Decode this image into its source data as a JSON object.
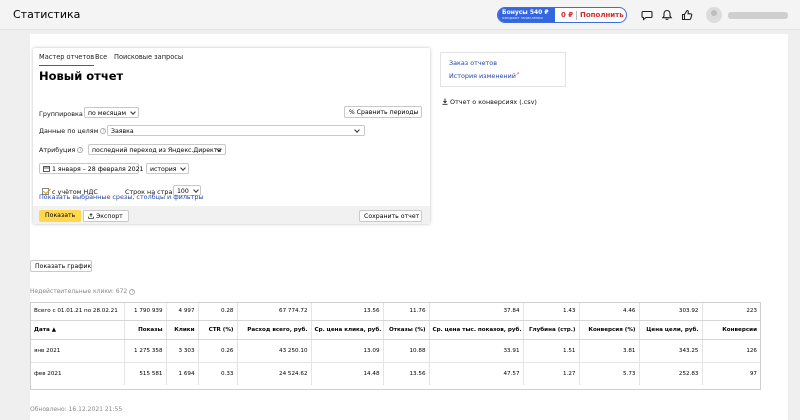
{
  "header": {
    "title": "Статистика",
    "bonus_title": "Бонусы 540 ₽",
    "bonus_subtitle": "ожидают зачисления",
    "balance": "0 ₽",
    "topup_label": "Пополнить",
    "icons": [
      "chat-icon",
      "bell-icon",
      "thumbs-up-icon",
      "avatar-icon"
    ]
  },
  "tabs": [
    {
      "label": "Мастер отчетов",
      "active": true
    },
    {
      "label": "Все",
      "active": false
    },
    {
      "label": "Поисковые запросы",
      "active": false
    }
  ],
  "report": {
    "title": "Новый отчет",
    "grouping_label": "Группировка",
    "grouping_value": "по месяцам",
    "compare_label": "Сравнить периоды",
    "goals_label": "Данные по целям",
    "goals_value": "Заявка",
    "attribution_label": "Атрибуция",
    "attribution_value": "последний переход из Яндекс.Директа",
    "date_range": "1 января – 28 февраля 2021",
    "history_label": "история",
    "vat_label": "с учётом НДС",
    "vat_checked": true,
    "rows_label": "Строк на странице",
    "rows_value": "100",
    "slices_link": "Показать выбранные срезы, столбцы и фильтры",
    "show_button": "Показать",
    "export_button": "Экспорт",
    "save_button": "Сохранить отчет"
  },
  "side": {
    "order_reports": "Заказ отчетов",
    "change_history": "История изменений",
    "conversions_report": "Отчет о конверсиях (.csv)"
  },
  "show_chart_button": "Показать график",
  "invalid_clicks": "Недействительные клики: 672",
  "table": {
    "total": [
      "Всего с 01.01.21 по 28.02.21",
      "1 790 939",
      "4 997",
      "0.28",
      "67 774.72",
      "13.56",
      "11.76",
      "37.84",
      "1.43",
      "4.46",
      "303.92",
      "223"
    ],
    "headers": [
      "Дата ▲",
      "Показы",
      "Клики",
      "CTR (%)",
      "Расход всего, руб.",
      "Ср. цена клика, руб.",
      "Отказы (%)",
      "Ср. цена тыс. показов, руб.",
      "Глубина (стр.)",
      "Конверсия (%)",
      "Цена цели, руб.",
      "Конверсии"
    ],
    "rows": [
      [
        "янв 2021",
        "1 275 358",
        "3 303",
        "0.26",
        "43 250.10",
        "13.09",
        "10.88",
        "33.91",
        "1.51",
        "3.81",
        "343.25",
        "126"
      ],
      [
        "фев 2021",
        "515 581",
        "1 694",
        "0.33",
        "24 524.62",
        "14.48",
        "13.56",
        "47.57",
        "1.27",
        "5.73",
        "252.83",
        "97"
      ]
    ]
  },
  "updated": "Обновлено: 16.12.2021 21:55",
  "colors": {
    "accent": "#ffd84c",
    "link": "#2345a8",
    "brand_blue": "#3466dd",
    "alert_red": "#d42c2c"
  }
}
